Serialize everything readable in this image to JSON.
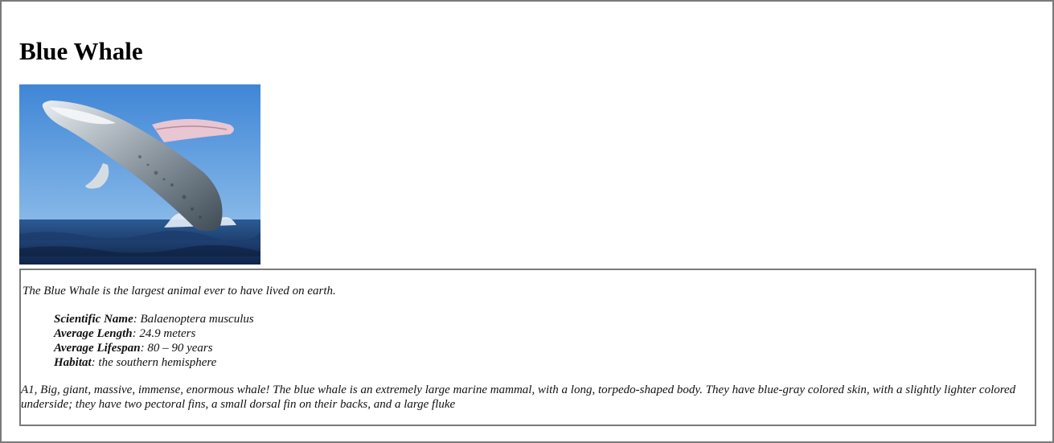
{
  "page": {
    "title": "Blue Whale"
  },
  "image": {
    "alt": "Whale breaching out of the ocean",
    "colors": {
      "sky": "#4f95d8",
      "sea": "#1f3f72"
    }
  },
  "info": {
    "intro": "The Blue Whale is the largest animal ever to have lived on earth.",
    "facts": [
      {
        "label": "Scientific Name",
        "value": ": Balaenoptera musculus"
      },
      {
        "label": "Average Length",
        "value": ": 24.9 meters"
      },
      {
        "label": "Average Lifespan",
        "value": ": 80 – 90 years"
      },
      {
        "label": "Habitat",
        "value": ": the southern hemisphere"
      }
    ],
    "description": "A1, Big, giant, massive, immense, enormous whale! The blue whale is an extremely large marine mammal, with a long, torpedo-shaped body. They have blue-gray colored skin, with a slightly lighter colored underside; they have two pectoral fins, a small dorsal fin on their backs, and a large fluke"
  }
}
